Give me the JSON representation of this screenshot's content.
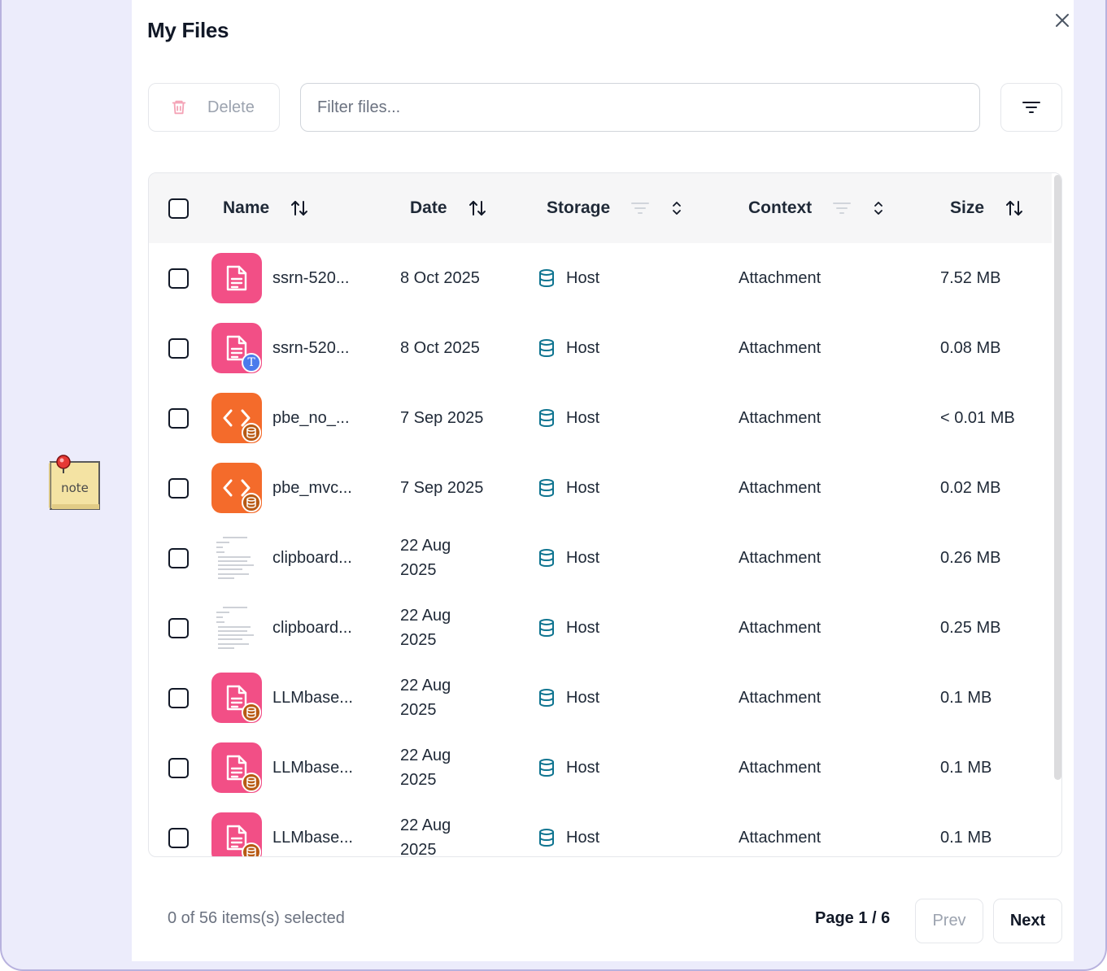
{
  "window": {
    "title": "My Files"
  },
  "toolbar": {
    "delete_label": "Delete",
    "filter_placeholder": "Filter files...",
    "filter_value": ""
  },
  "table": {
    "columns": {
      "name": "Name",
      "date": "Date",
      "storage": "Storage",
      "context": "Context",
      "size": "Size"
    },
    "rows": [
      {
        "name": "ssrn-520...",
        "date_line1": "8 Oct 2025",
        "date_line2": "",
        "storage": "Host",
        "context": "Attachment",
        "size": "7.52 MB",
        "icon": "document-icon",
        "badge": ""
      },
      {
        "name": "ssrn-520...",
        "date_line1": "8 Oct 2025",
        "date_line2": "",
        "storage": "Host",
        "context": "Attachment",
        "size": "0.08 MB",
        "icon": "document-icon",
        "badge": "text-badge-icon"
      },
      {
        "name": "pbe_no_...",
        "date_line1": "7 Sep 2025",
        "date_line2": "",
        "storage": "Host",
        "context": "Attachment",
        "size": "< 0.01 MB",
        "icon": "code-icon",
        "badge": "database-badge-icon"
      },
      {
        "name": "pbe_mvc...",
        "date_line1": "7 Sep 2025",
        "date_line2": "",
        "storage": "Host",
        "context": "Attachment",
        "size": "0.02 MB",
        "icon": "code-icon",
        "badge": "database-badge-icon"
      },
      {
        "name": "clipboard...",
        "date_line1": "22 Aug",
        "date_line2": "2025",
        "storage": "Host",
        "context": "Attachment",
        "size": "0.26 MB",
        "icon": "image-thumbnail",
        "badge": ""
      },
      {
        "name": "clipboard...",
        "date_line1": "22 Aug",
        "date_line2": "2025",
        "storage": "Host",
        "context": "Attachment",
        "size": "0.25 MB",
        "icon": "image-thumbnail",
        "badge": ""
      },
      {
        "name": "LLMbase...",
        "date_line1": "22 Aug",
        "date_line2": "2025",
        "storage": "Host",
        "context": "Attachment",
        "size": "0.1 MB",
        "icon": "document-icon",
        "badge": "database-badge-icon"
      },
      {
        "name": "LLMbase...",
        "date_line1": "22 Aug",
        "date_line2": "2025",
        "storage": "Host",
        "context": "Attachment",
        "size": "0.1 MB",
        "icon": "document-icon",
        "badge": "database-badge-icon"
      },
      {
        "name": "LLMbase...",
        "date_line1": "22 Aug",
        "date_line2": "2025",
        "storage": "Host",
        "context": "Attachment",
        "size": "0.1 MB",
        "icon": "document-icon",
        "badge": "database-badge-icon"
      }
    ]
  },
  "footer": {
    "selection": "0 of 56 items(s) selected",
    "page": "Page 1 / 6",
    "prev_label": "Prev",
    "next_label": "Next"
  },
  "desktop": {
    "note_text": "note"
  },
  "colors": {
    "pink_file": "#f24f86",
    "orange_file": "#f46b2b",
    "storage_icon": "#0e7490",
    "backdrop": "#ececfb"
  }
}
